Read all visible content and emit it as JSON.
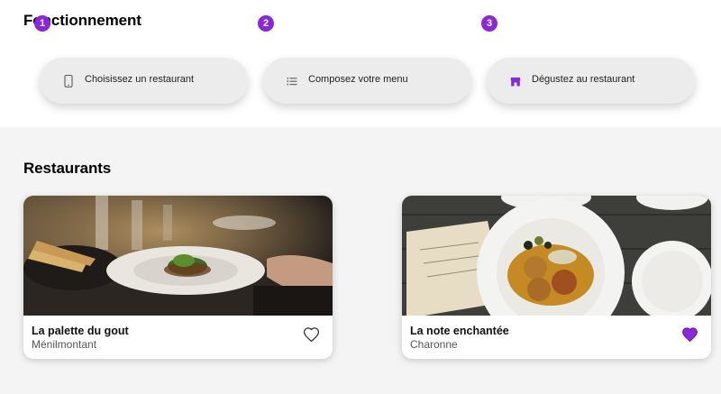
{
  "how": {
    "title": "Fonctionnement",
    "steps": [
      {
        "number": "1",
        "icon": "smartphone-icon",
        "label": "Choisissez un restaurant"
      },
      {
        "number": "2",
        "icon": "list-icon",
        "label": "Composez votre menu"
      },
      {
        "number": "3",
        "icon": "storefront-icon",
        "label": "Dégustez au restaurant"
      }
    ]
  },
  "restaurants": {
    "title": "Restaurants",
    "cards": [
      {
        "name": "La palette du gout",
        "area": "Ménilmontant",
        "favorite": false,
        "heart_icon": "heart-outline-icon"
      },
      {
        "name": "La note enchantée",
        "area": "Charonne",
        "favorite": true,
        "heart_icon": "heart-filled-icon"
      }
    ]
  },
  "colors": {
    "accent": "#8b27d6",
    "section_bg": "#f4f4f4",
    "step_bg": "#ececec"
  }
}
